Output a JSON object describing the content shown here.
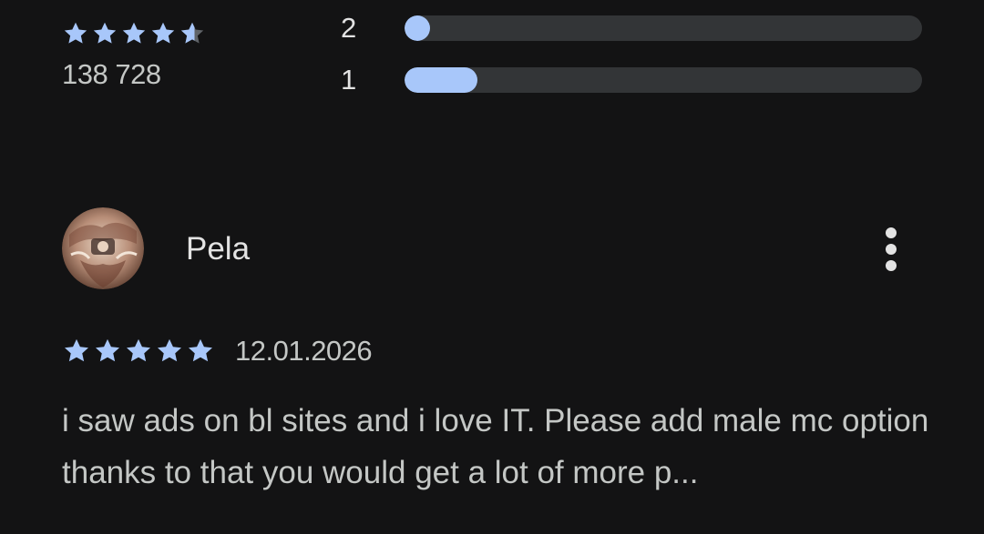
{
  "summary": {
    "rating": 4.6,
    "review_count": "138 728",
    "bars": [
      {
        "label": "2",
        "fraction": 0.05
      },
      {
        "label": "1",
        "fraction": 0.14
      }
    ]
  },
  "review": {
    "reviewer": "Pela",
    "stars": 5,
    "date": "12.01.2026",
    "text": "i saw ads on bl sites and i love IT. Please add male mc option thanks to that you would get a lot of more p..."
  },
  "colors": {
    "accent": "#a8c7fa",
    "track": "#333537",
    "star_empty": "#5f6368",
    "background": "#131314"
  },
  "icons": {
    "avatar": "reviewer-avatar",
    "more": "more-vert-icon",
    "star": "star-icon"
  }
}
